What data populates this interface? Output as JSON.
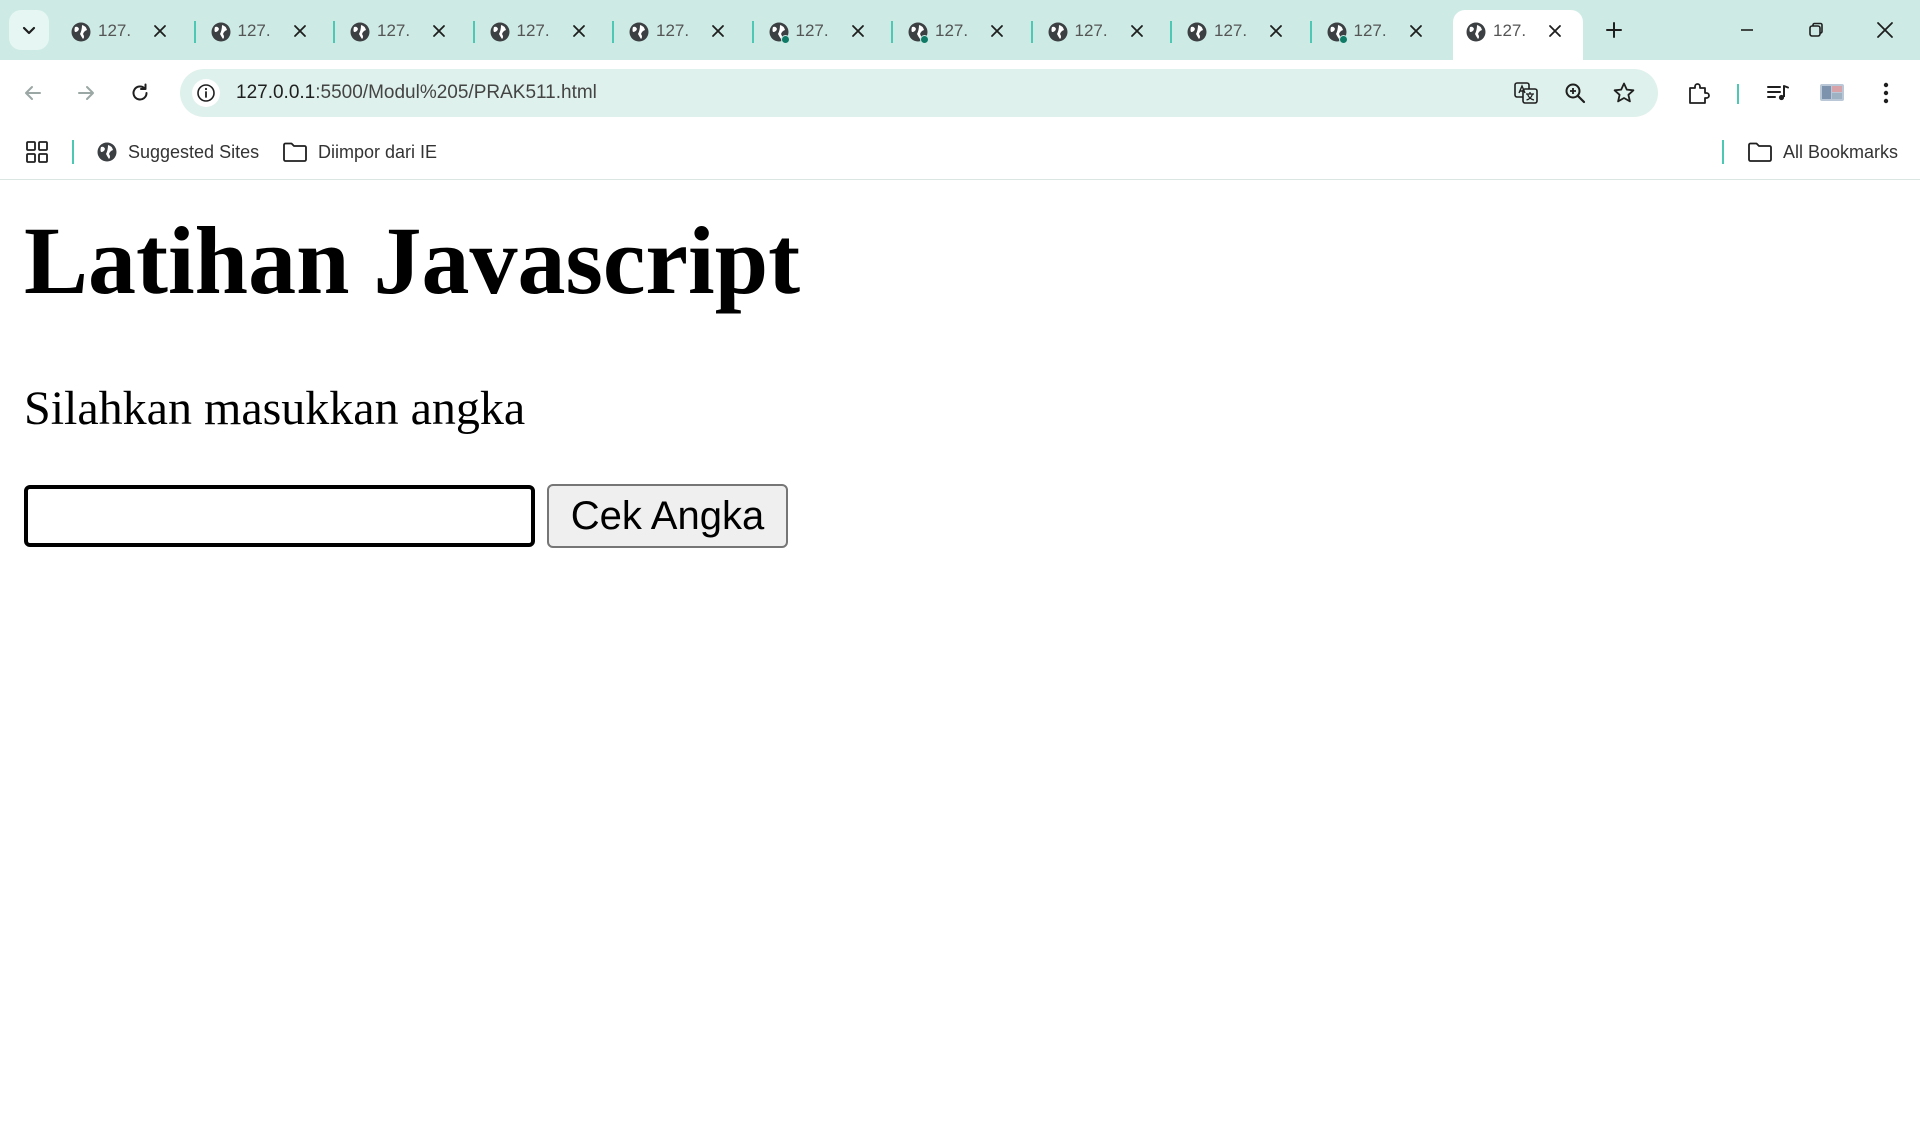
{
  "browser": {
    "tabs": [
      {
        "title": "127.",
        "active": false,
        "indicator": false
      },
      {
        "title": "127.",
        "active": false,
        "indicator": false
      },
      {
        "title": "127.",
        "active": false,
        "indicator": false
      },
      {
        "title": "127.",
        "active": false,
        "indicator": false
      },
      {
        "title": "127.",
        "active": false,
        "indicator": false
      },
      {
        "title": "127.",
        "active": false,
        "indicator": true
      },
      {
        "title": "127.",
        "active": false,
        "indicator": true
      },
      {
        "title": "127.",
        "active": false,
        "indicator": false
      },
      {
        "title": "127.",
        "active": false,
        "indicator": false
      },
      {
        "title": "127.",
        "active": false,
        "indicator": true
      },
      {
        "title": "127.",
        "active": true,
        "indicator": false
      }
    ],
    "address": {
      "host": "127.0.0.1",
      "path": ":5500/Modul%205/PRAK511.html"
    },
    "bookmarks": {
      "suggested_sites": "Suggested Sites",
      "imported": "Diimpor dari IE",
      "all_bookmarks": "All Bookmarks"
    },
    "colors": {
      "tabstrip": "#cdeae4",
      "omnibox": "#dff1ec",
      "accent": "#4dc8b4"
    }
  },
  "page": {
    "heading": "Latihan Javascript",
    "prompt": "Silahkan masukkan angka",
    "input_value": "",
    "button_label": "Cek Angka"
  }
}
